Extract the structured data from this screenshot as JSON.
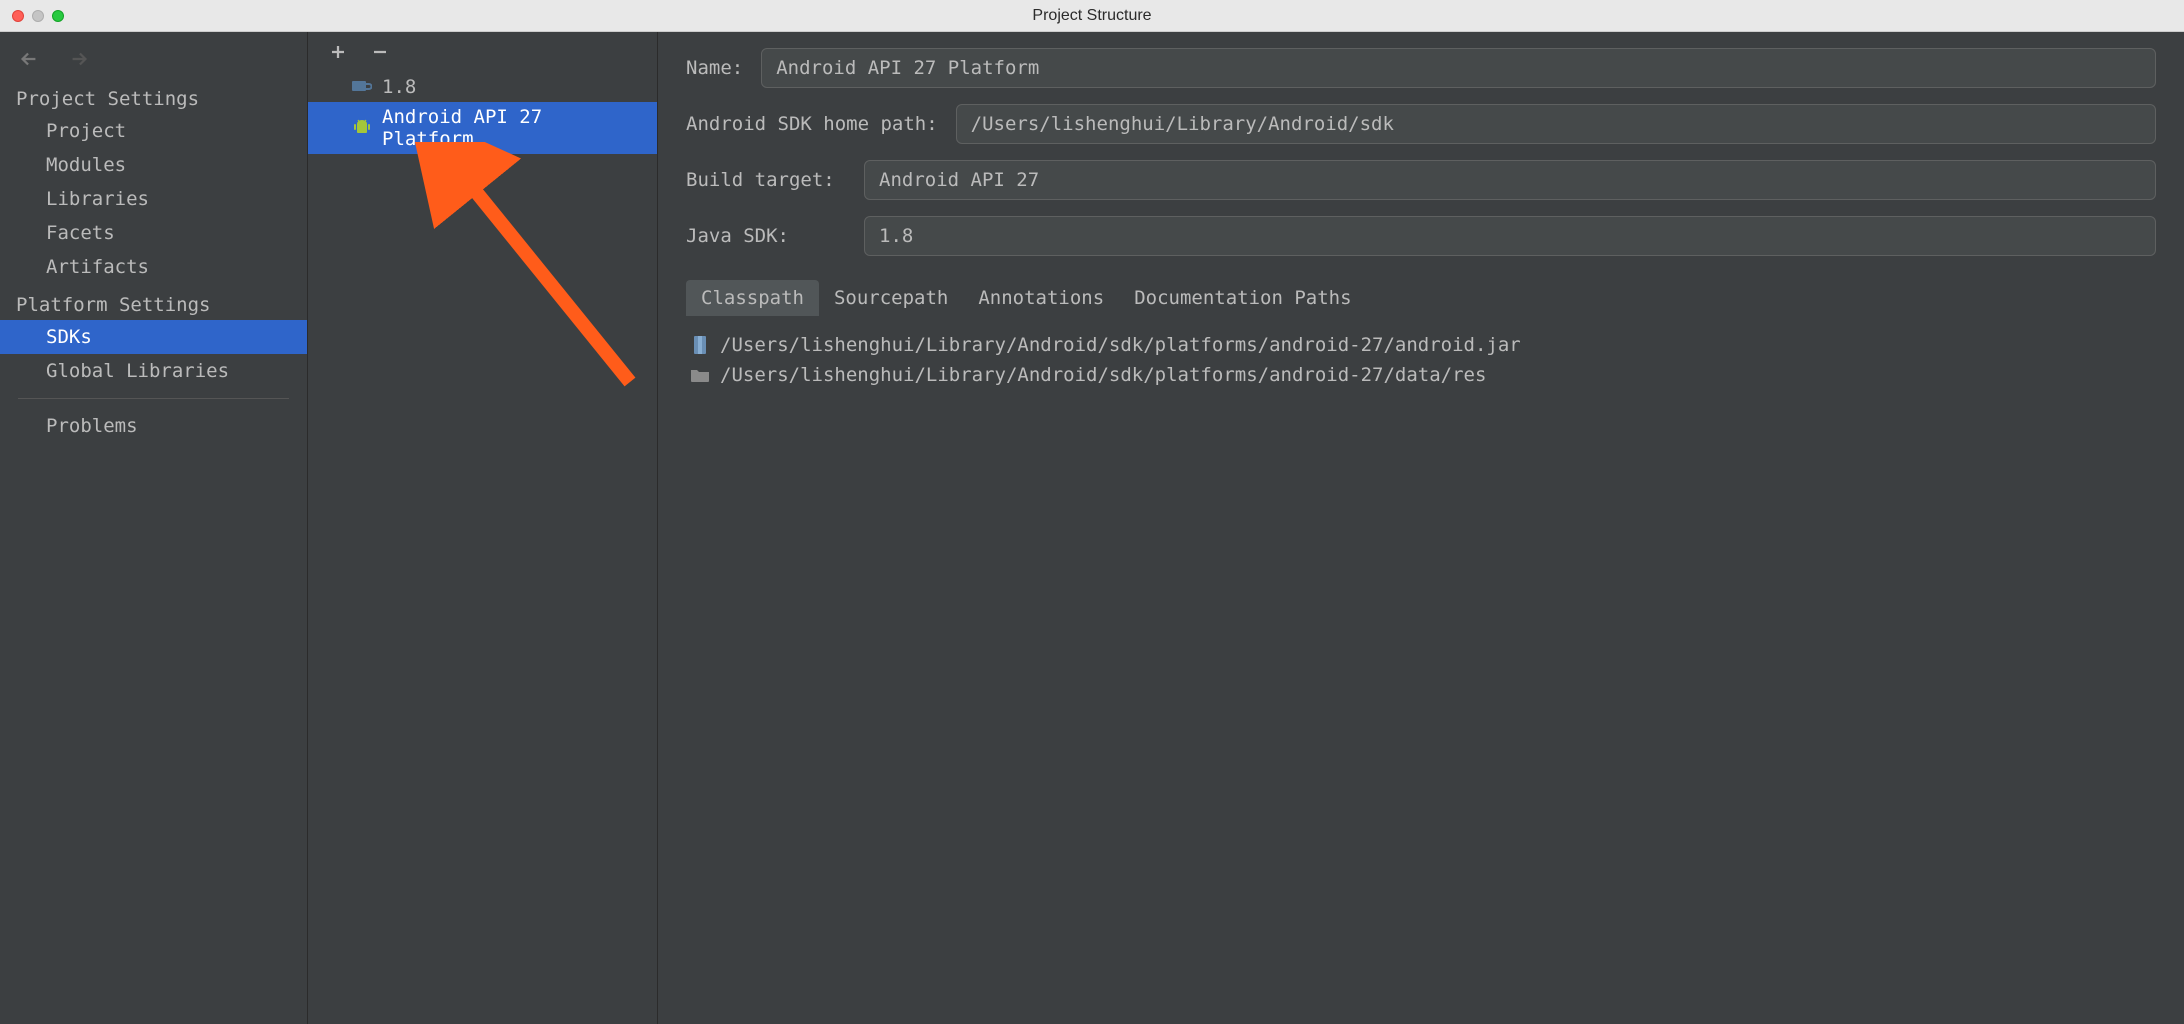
{
  "window": {
    "title": "Project Structure"
  },
  "sections": {
    "project_settings": {
      "label": "Project Settings",
      "items": [
        "Project",
        "Modules",
        "Libraries",
        "Facets",
        "Artifacts"
      ]
    },
    "platform_settings": {
      "label": "Platform Settings",
      "items": [
        "SDKs",
        "Global Libraries"
      ]
    },
    "problems": {
      "label": "Problems"
    }
  },
  "sdk_list": {
    "items": [
      {
        "icon": "java-icon",
        "label": "1.8"
      },
      {
        "icon": "android-icon",
        "label": "Android API 27 Platform"
      }
    ],
    "selected_index": 1
  },
  "details": {
    "name_label": "Name:",
    "name_value": "Android API 27 Platform",
    "sdk_home_label": "Android SDK home path:",
    "sdk_home_value": "/Users/lishenghui/Library/Android/sdk",
    "build_target_label": "Build target:",
    "build_target_value": "Android API 27",
    "java_sdk_label": "Java SDK:",
    "java_sdk_value": "1.8",
    "tabs": [
      "Classpath",
      "Sourcepath",
      "Annotations",
      "Documentation Paths"
    ],
    "classpath": [
      {
        "icon": "jar-icon",
        "path": "/Users/lishenghui/Library/Android/sdk/platforms/android-27/android.jar"
      },
      {
        "icon": "folder-icon",
        "path": "/Users/lishenghui/Library/Android/sdk/platforms/android-27/data/res"
      }
    ]
  }
}
